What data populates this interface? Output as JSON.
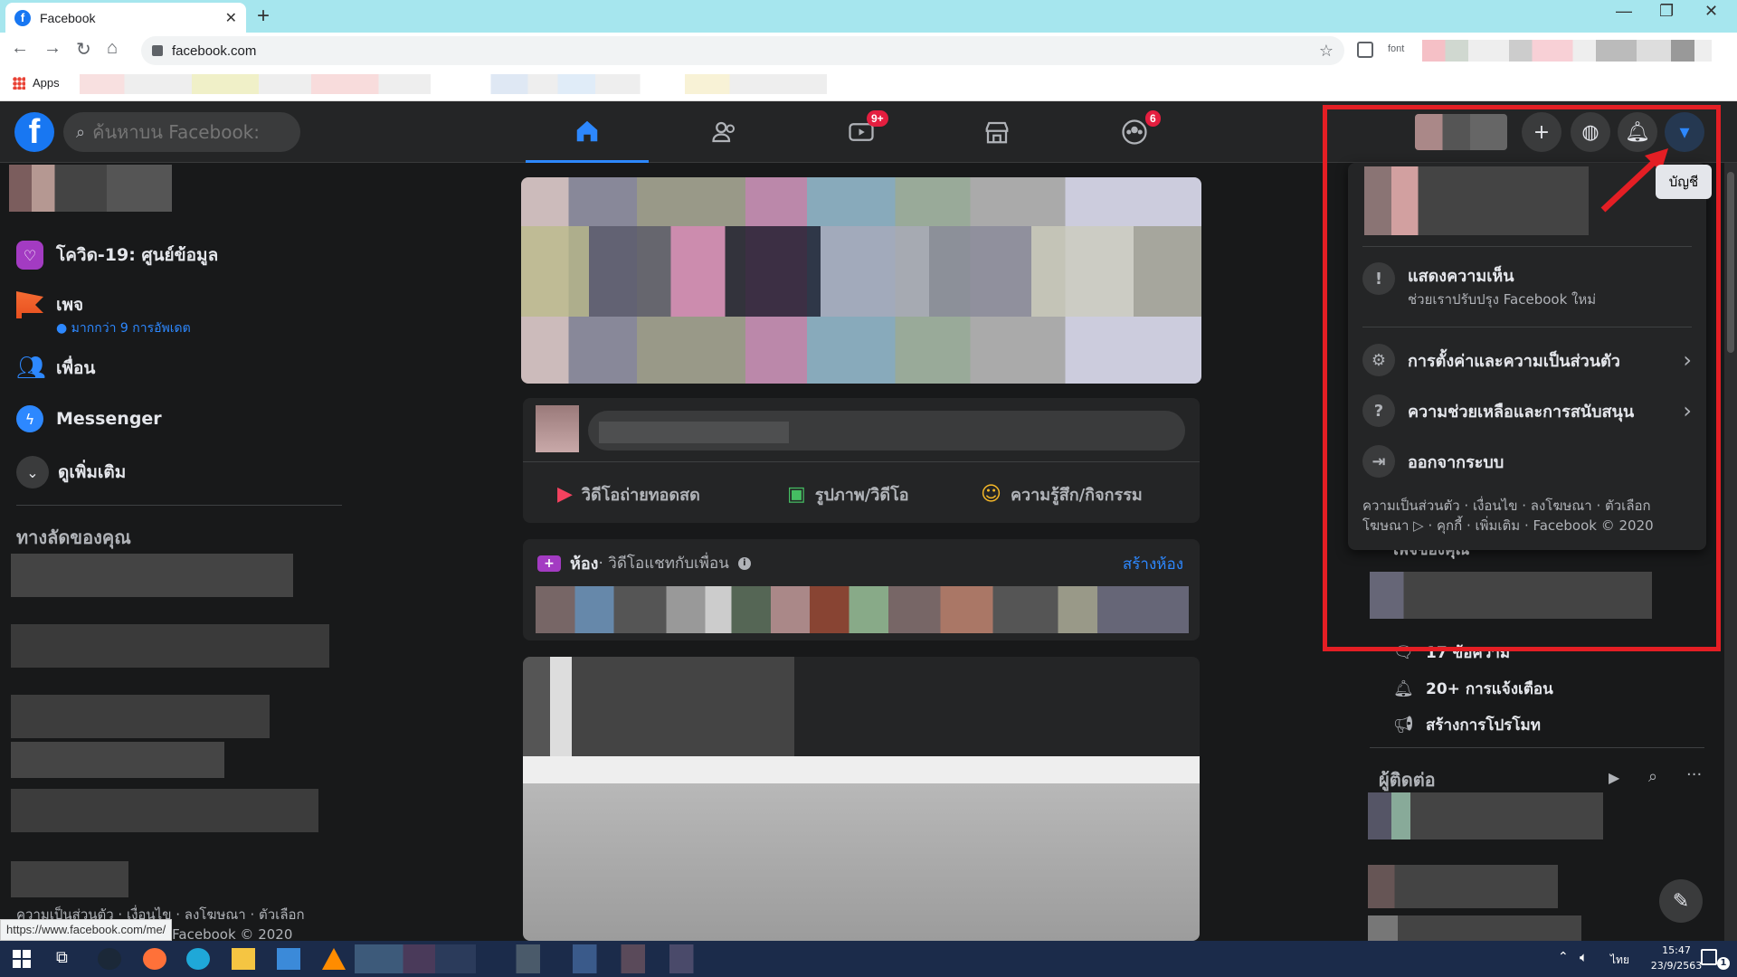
{
  "browser": {
    "tab_title": "Facebook",
    "url": "facebook.com",
    "bookmarks_apps": "Apps",
    "ext_label": "font",
    "status_url": "https://www.facebook.com/me/"
  },
  "header": {
    "search_placeholder": "ค้นหาบน Facebook:",
    "watch_badge": "9+",
    "groups_badge": "6"
  },
  "left_nav": {
    "covid": "โควิด-19: ศูนย์ข้อมูล",
    "pages": "เพจ",
    "pages_sub": "มากกว่า 9 การอัพเดต",
    "friends": "เพื่อน",
    "messenger": "Messenger",
    "see_more": "ดูเพิ่มเติม",
    "shortcuts_heading": "ทางลัดของคุณ",
    "footer_line1": "ความเป็นส่วนตัว · เงื่อนไข · ลงโฆษณา · ตัวเลือก",
    "footer_line2": "โฆษณา · คุกกี้ · เพิ่มเติม · Facebook © 2020"
  },
  "composer": {
    "live_video": "วิดีโอถ่ายทอดสด",
    "photo_video": "รูปภาพ/วิดีโอ",
    "feeling": "ความรู้สึก/กิจกรรม"
  },
  "rooms": {
    "title": "ห้อง",
    "subtitle": " · วิดีโอแชทกับเพื่อน",
    "create": "สร้างห้อง"
  },
  "account_menu": {
    "tooltip": "บัญชี",
    "feedback_title": "แสดงความเห็น",
    "feedback_sub": "ช่วยเราปรับปรุง Facebook ใหม่",
    "settings": "การตั้งค่าและความเป็นส่วนตัว",
    "help": "ความช่วยเหลือและการสนับสนุน",
    "logout": "ออกจากระบบ",
    "footer": "ความเป็นส่วนตัว · เงื่อนไข · ลงโฆษณา · ตัวเลือกโฆษณา ▷ · คุกกี้ · เพิ่มเติม · Facebook © 2020"
  },
  "right_col": {
    "your_pages": "เพจของคุณ",
    "messages": "17 ข้อความ",
    "notifications": "20+ การแจ้งเตือน",
    "create_promo": "สร้างการโปรโมท",
    "contacts": "ผู้ติดต่อ"
  },
  "taskbar": {
    "time": "15:47",
    "date": "23/9/2563",
    "lang": "ไทย",
    "notif_count": "1"
  },
  "colors": {
    "accent": "#2d88ff",
    "annotation": "#e41e24",
    "fb_blue": "#1877f2"
  }
}
